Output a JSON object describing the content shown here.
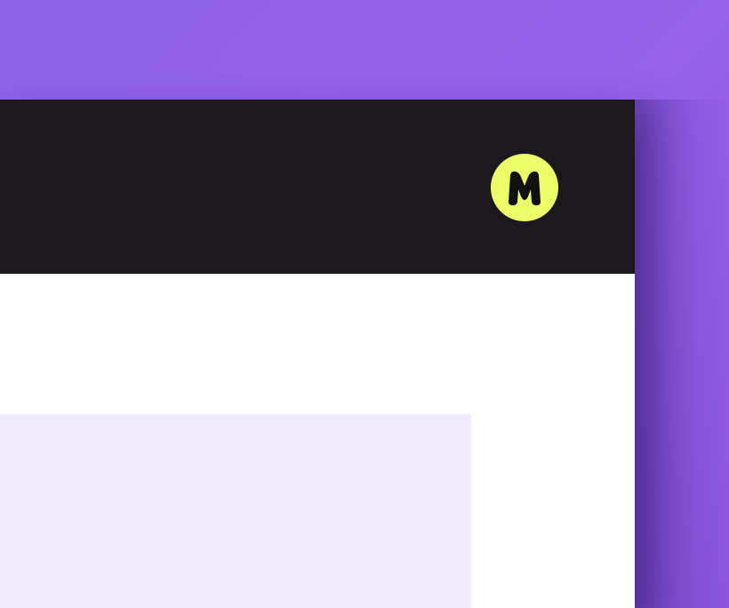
{
  "colors": {
    "page_background": "#9562e8",
    "header_background": "#1b191e",
    "content_background": "#ffffff",
    "card_background": "#f0ebfd",
    "avatar_background": "#edfd6a",
    "avatar_glyph": "#111111"
  },
  "header": {
    "avatar": {
      "icon": "letter-m-logo-icon"
    }
  }
}
